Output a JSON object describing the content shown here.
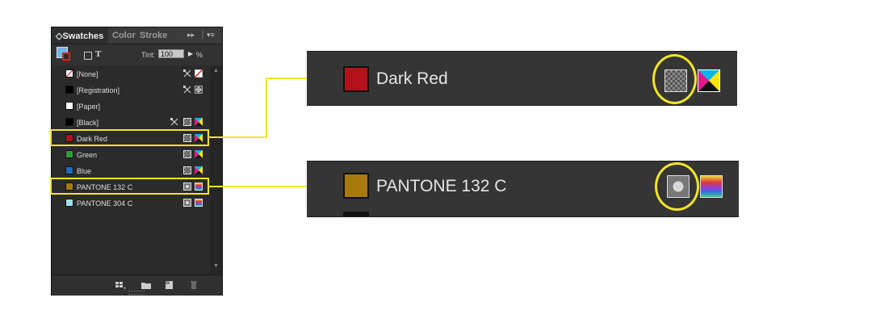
{
  "panel": {
    "tabs": [
      {
        "label": "Swatches",
        "prefix": "◇"
      },
      {
        "label": "Color"
      },
      {
        "label": "Stroke"
      }
    ],
    "collapse_icon": "double-arrow-icon",
    "menu_icon": "panel-menu-icon",
    "toolbar": {
      "text_icon_label": "T",
      "tint_label": "Tint:",
      "tint_value": "100",
      "tint_unit": "%"
    },
    "swatches": [
      {
        "name": "[None]",
        "color": "none",
        "icons": [
          "no-edit-icon",
          "none-icon"
        ]
      },
      {
        "name": "[Registration]",
        "color": "#000000",
        "icons": [
          "no-edit-icon",
          "registration-icon"
        ]
      },
      {
        "name": "[Paper]",
        "color": "#ffffff",
        "icons": []
      },
      {
        "name": "[Black]",
        "color": "#000000",
        "icons": [
          "no-edit-icon",
          "process-icon",
          "cmyk-icon"
        ]
      },
      {
        "name": "Dark Red",
        "color": "#b3121a",
        "icons": [
          "process-icon",
          "cmyk-icon"
        ]
      },
      {
        "name": "Green",
        "color": "#2f9e3a",
        "icons": [
          "process-icon",
          "cmyk-icon"
        ]
      },
      {
        "name": "Blue",
        "color": "#1a6fbf",
        "icons": [
          "process-icon",
          "cmyk-icon"
        ]
      },
      {
        "name": "PANTONE 132 C",
        "color": "#a87a0d",
        "icons": [
          "spot-icon",
          "lab-icon"
        ]
      },
      {
        "name": "PANTONE 304 C",
        "color": "#9fe0f0",
        "icons": [
          "spot-icon",
          "lab-icon"
        ]
      }
    ],
    "footer_icons": [
      "show-swatch-kinds-icon",
      "new-color-group-icon",
      "new-swatch-icon",
      "delete-swatch-icon"
    ]
  },
  "callouts": [
    {
      "name": "Dark Red",
      "color": "#b3121a",
      "type_icon": "process-icon",
      "mode_icon": "cmyk-icon"
    },
    {
      "name": "PANTONE 132 C",
      "color": "#a87a0d",
      "type_icon": "spot-icon",
      "mode_icon": "lab-icon"
    }
  ],
  "colors": {
    "highlight": "#f2e529",
    "panel_bg": "#2b2b2b"
  }
}
